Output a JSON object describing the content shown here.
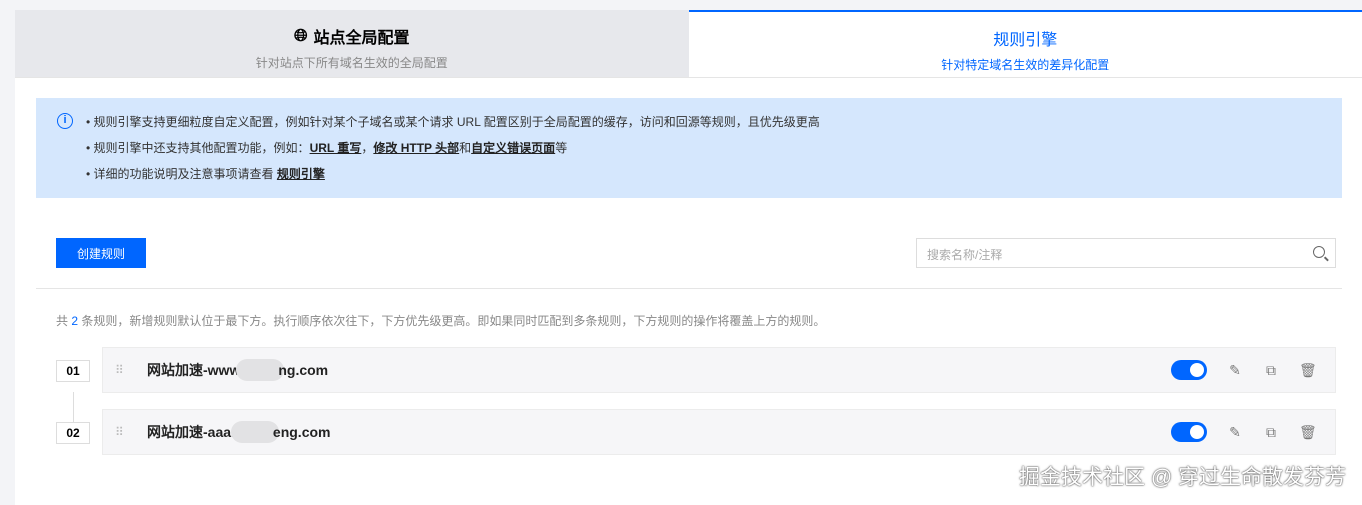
{
  "tabs": [
    {
      "title": "站点全局配置",
      "subtitle": "针对站点下所有域名生效的全局配置"
    },
    {
      "title": "规则引擎",
      "subtitle": "针对特定域名生效的差异化配置"
    }
  ],
  "info": {
    "line1": "规则引擎支持更细粒度自定义配置，例如针对某个子域名或某个请求 URL 配置区别于全局配置的缓存，访问和回源等规则，且优先级更高",
    "line2_prefix": "规则引擎中还支持其他配置功能，例如：",
    "link_url_rewrite": "URL 重写",
    "sep1": "，",
    "link_http_header": "修改 HTTP 头部",
    "sep2": "和",
    "link_error_page": "自定义错误页面",
    "line2_suffix": "等",
    "line3_prefix": "详细的功能说明及注意事项请查看 ",
    "link_rule_engine": "规则引擎"
  },
  "create_button": "创建规则",
  "search_placeholder": "搜索名称/注释",
  "summary": {
    "prefix": "共 ",
    "count": "2",
    "suffix": " 条规则，新增规则默认位于最下方。执行顺序依次往下，下方优先级更高。即如果同时匹配到多条规则，下方规则的操作将覆盖上方的规则。"
  },
  "rules": [
    {
      "index": "01",
      "name_start": "网站加速-www",
      "name_end": "ng.com",
      "enabled": true
    },
    {
      "index": "02",
      "name_start": "网站加速-aaa.",
      "name_end": "eng.com",
      "enabled": true
    }
  ],
  "watermark": "掘金技术社区 @ 穿过生命散发芬芳"
}
